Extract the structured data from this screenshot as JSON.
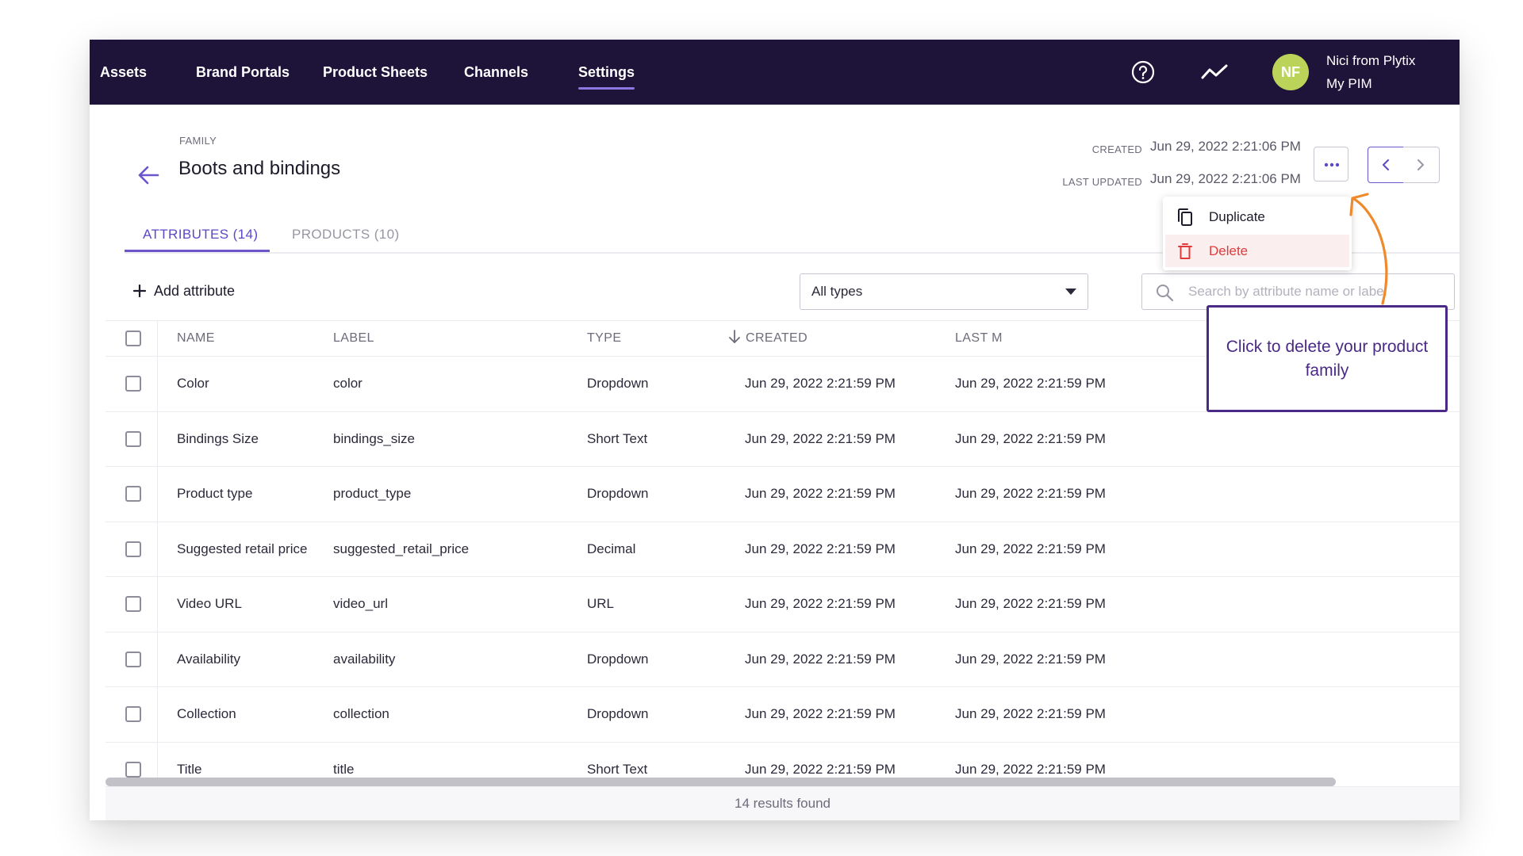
{
  "nav": {
    "items": [
      {
        "label": "Assets",
        "active": false
      },
      {
        "label": "Brand Portals",
        "active": false
      },
      {
        "label": "Product Sheets",
        "active": false
      },
      {
        "label": "Channels",
        "active": false
      },
      {
        "label": "Settings",
        "active": true
      }
    ],
    "user": {
      "initials": "NF",
      "name": "Nici from Plytix",
      "org": "My PIM"
    }
  },
  "header": {
    "caption": "FAMILY",
    "title": "Boots and bindings",
    "created_label": "CREATED",
    "created_value": "Jun 29, 2022 2:21:06 PM",
    "updated_label": "LAST UPDATED",
    "updated_value": "Jun 29, 2022 2:21:06 PM"
  },
  "tabs": [
    {
      "label": "ATTRIBUTES (14)",
      "active": true
    },
    {
      "label": "PRODUCTS (10)",
      "active": false
    }
  ],
  "toolbar": {
    "add_label": "Add attribute",
    "type_filter": "All types",
    "search_placeholder": "Search by attribute name or label"
  },
  "menu": {
    "duplicate": "Duplicate",
    "delete": "Delete"
  },
  "table": {
    "columns": {
      "name": "NAME",
      "label": "LABEL",
      "type": "TYPE",
      "created": "CREATED",
      "last_modified": "LAST M"
    },
    "rows": [
      {
        "name": "Color",
        "label": "color",
        "type": "Dropdown",
        "created": "Jun 29, 2022 2:21:59 PM",
        "modified": "Jun 29, 2022 2:21:59 PM"
      },
      {
        "name": "Bindings Size",
        "label": "bindings_size",
        "type": "Short Text",
        "created": "Jun 29, 2022 2:21:59 PM",
        "modified": "Jun 29, 2022 2:21:59 PM"
      },
      {
        "name": "Product type",
        "label": "product_type",
        "type": "Dropdown",
        "created": "Jun 29, 2022 2:21:59 PM",
        "modified": "Jun 29, 2022 2:21:59 PM"
      },
      {
        "name": "Suggested retail price",
        "label": "suggested_retail_price",
        "type": "Decimal",
        "created": "Jun 29, 2022 2:21:59 PM",
        "modified": "Jun 29, 2022 2:21:59 PM"
      },
      {
        "name": "Video URL",
        "label": "video_url",
        "type": "URL",
        "created": "Jun 29, 2022 2:21:59 PM",
        "modified": "Jun 29, 2022 2:21:59 PM"
      },
      {
        "name": "Availability",
        "label": "availability",
        "type": "Dropdown",
        "created": "Jun 29, 2022 2:21:59 PM",
        "modified": "Jun 29, 2022 2:21:59 PM"
      },
      {
        "name": "Collection",
        "label": "collection",
        "type": "Dropdown",
        "created": "Jun 29, 2022 2:21:59 PM",
        "modified": "Jun 29, 2022 2:21:59 PM"
      },
      {
        "name": "Title",
        "label": "title",
        "type": "Short Text",
        "created": "Jun 29, 2022 2:21:59 PM",
        "modified": "Jun 29, 2022 2:21:59 PM"
      }
    ]
  },
  "footer": {
    "results": "14 results found"
  },
  "callout": {
    "text": "Click to delete your product family"
  },
  "colors": {
    "nav_bg": "#1e1338",
    "accent": "#6c56c9",
    "delete_red": "#e13a3a",
    "callout_purple": "#4a2a86",
    "arrow_orange": "#ee8a2c",
    "avatar": "#bcd35a"
  }
}
